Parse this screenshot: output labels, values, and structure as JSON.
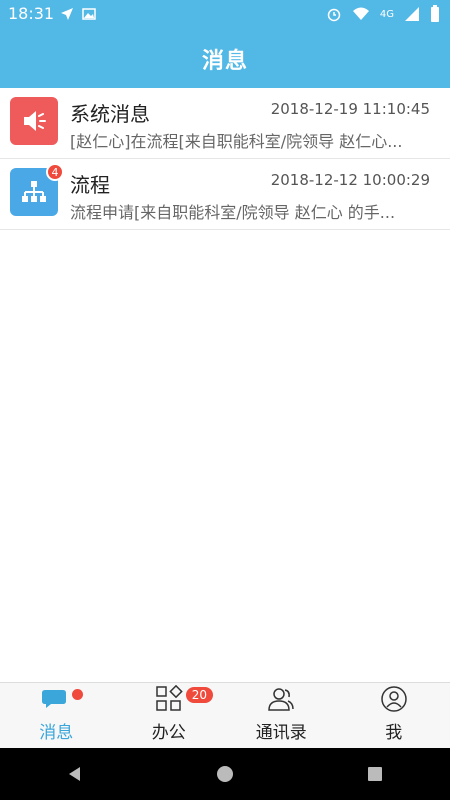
{
  "status": {
    "time": "18:31",
    "network": "4G"
  },
  "header": {
    "title": "消息"
  },
  "messages": [
    {
      "title": "系统消息",
      "time": "2018-12-19 11:10:45",
      "preview": "[赵仁心]在流程[来自职能科室/院领导 赵仁心...",
      "icon": "speaker-icon",
      "color": "#ef5a5a"
    },
    {
      "title": "流程",
      "time": "2018-12-12 10:00:29",
      "preview": "流程申请[来自职能科室/院领导 赵仁心 的手...",
      "icon": "org-chart-icon",
      "color": "#4aa8e6",
      "badge": "4"
    }
  ],
  "tabs": [
    {
      "label": "消息",
      "icon": "chat-icon",
      "active": true
    },
    {
      "label": "办公",
      "icon": "apps-icon",
      "badge": "20"
    },
    {
      "label": "通讯录",
      "icon": "contacts-icon"
    },
    {
      "label": "我",
      "icon": "profile-icon"
    }
  ],
  "colors": {
    "primary": "#52b8e6",
    "badge": "#f04a3d"
  }
}
